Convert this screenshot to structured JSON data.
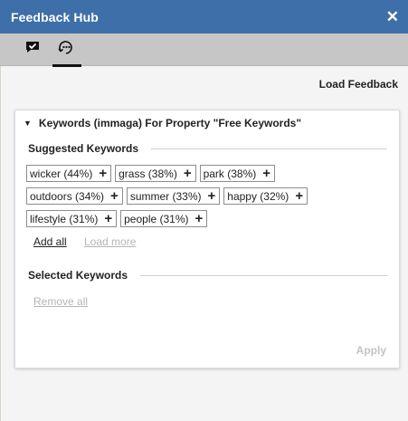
{
  "window": {
    "title": "Feedback Hub",
    "close_icon": "close-icon"
  },
  "toolbar": {
    "tabs": [
      {
        "icon": "feedback-check-icon",
        "active": false
      },
      {
        "icon": "keywords-icon",
        "active": true
      }
    ]
  },
  "actions": {
    "load_feedback": "Load Feedback"
  },
  "panel": {
    "header": "Keywords (immaga) For Property \"Free Keywords\"",
    "suggested": {
      "title": "Suggested Keywords",
      "rows": [
        [
          {
            "label": "wicker (44%)"
          },
          {
            "label": "grass (38%)"
          },
          {
            "label": "park (38%)"
          }
        ],
        [
          {
            "label": "outdoors (34%)"
          },
          {
            "label": "summer (33%)"
          },
          {
            "label": "happy (32%)"
          }
        ],
        [
          {
            "label": "lifestyle (31%)"
          },
          {
            "label": "people (31%)"
          }
        ]
      ],
      "add_symbol": "+",
      "add_all": "Add all",
      "load_more": "Load more"
    },
    "selected": {
      "title": "Selected Keywords",
      "remove_all": "Remove all"
    },
    "apply": "Apply"
  }
}
